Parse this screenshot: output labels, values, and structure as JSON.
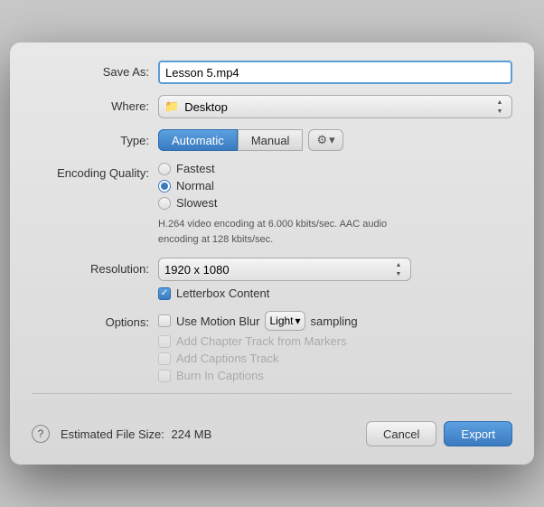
{
  "saveAs": {
    "label": "Save As:",
    "value": "Lesson 5.mp4"
  },
  "where": {
    "label": "Where:",
    "value": "Desktop",
    "icon": "📁"
  },
  "type": {
    "label": "Type:",
    "automaticLabel": "Automatic",
    "manualLabel": "Manual",
    "gearIcon": "⚙",
    "chevronIcon": "▾"
  },
  "encodingQuality": {
    "label": "Encoding Quality:",
    "options": [
      {
        "id": "fastest",
        "label": "Fastest",
        "selected": false
      },
      {
        "id": "normal",
        "label": "Normal",
        "selected": true
      },
      {
        "id": "slowest",
        "label": "Slowest",
        "selected": false
      }
    ],
    "infoText": "H.264 video encoding at 6.000 kbits/sec.  AAC audio encoding at 128 kbits/sec."
  },
  "resolution": {
    "label": "Resolution:",
    "value": "1920 x 1080"
  },
  "letterbox": {
    "label": "Letterbox Content",
    "checked": true
  },
  "options": {
    "label": "Options:",
    "useMotionBlur": {
      "label": "Use Motion Blur",
      "checked": false
    },
    "samplingLabel": "sampling",
    "motionBlurValue": "Light",
    "addChapterTrack": {
      "label": "Add Chapter Track from Markers",
      "checked": false,
      "disabled": true
    },
    "addCaptionsTrack": {
      "label": "Add Captions Track",
      "checked": false,
      "disabled": true
    },
    "burnInCaptions": {
      "label": "Burn In Captions",
      "checked": false,
      "disabled": true
    }
  },
  "estimatedFileSize": {
    "label": "Estimated File Size:",
    "value": "224 MB"
  },
  "buttons": {
    "cancel": "Cancel",
    "export": "Export",
    "help": "?"
  }
}
